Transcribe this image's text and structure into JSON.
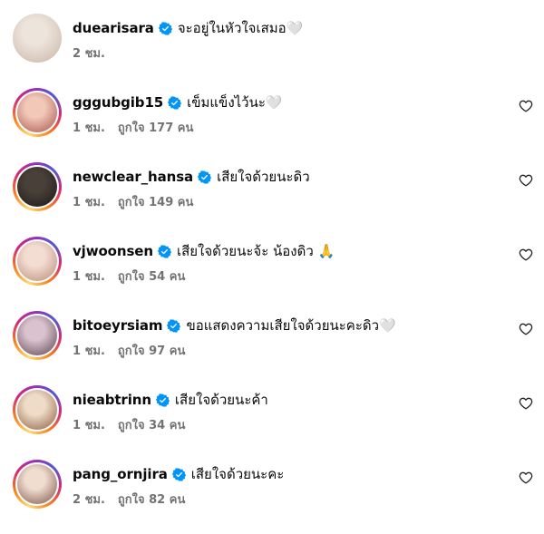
{
  "comments": [
    {
      "username": "duearisara",
      "text": "จะอยู่ในหัวใจเสมอ🤍",
      "time": "2 ชม.",
      "likes": "",
      "has_ring": false,
      "has_heart": false,
      "avatar_colors": [
        "#ede4dc",
        "#c9b4a4"
      ]
    },
    {
      "username": "gggubgib15",
      "text": "เข็มแข็งไว้นะ🤍",
      "time": "1 ชม.",
      "likes": "ถูกใจ 177 คน",
      "has_ring": true,
      "has_heart": true,
      "avatar_colors": [
        "#f2c8b8",
        "#a5524a"
      ]
    },
    {
      "username": "newclear_hansa",
      "text": "เสียใจด้วยนะดิว",
      "time": "1 ชม.",
      "likes": "ถูกใจ 149 คน",
      "has_ring": true,
      "has_heart": true,
      "avatar_colors": [
        "#4a403a",
        "#1c1816"
      ]
    },
    {
      "username": "vjwoonsen",
      "text": "เสียใจด้วยนะจ้ะ น้องดิว 🙏",
      "time": "1 ชม.",
      "likes": "ถูกใจ 54 คน",
      "has_ring": true,
      "has_heart": true,
      "avatar_colors": [
        "#f3ddd2",
        "#b88a76"
      ]
    },
    {
      "username": "bitoeyrsiam",
      "text": "ขอแสดงความเสียใจด้วยนะคะดิว🤍",
      "time": "1 ชม.",
      "likes": "ถูกใจ 97 คน",
      "has_ring": true,
      "has_heart": true,
      "avatar_colors": [
        "#d9c3cf",
        "#5a3f4c"
      ]
    },
    {
      "username": "nieabtrinn",
      "text": "เสียใจด้วยนะค้า",
      "time": "1 ชม.",
      "likes": "ถูกใจ 34 คน",
      "has_ring": true,
      "has_heart": true,
      "avatar_colors": [
        "#efdcc8",
        "#8a5a3c"
      ]
    },
    {
      "username": "pang_ornjira",
      "text": "เสียใจด้วยนะคะ",
      "time": "2 ชม.",
      "likes": "ถูกใจ 82 คน",
      "has_ring": true,
      "has_heart": true,
      "avatar_colors": [
        "#f0ddd0",
        "#7a5244"
      ]
    }
  ],
  "icons": {
    "verified": "verified-badge-icon",
    "like": "heart-outline-icon"
  },
  "colors": {
    "verified": "#0095f6",
    "meta_text": "#737373",
    "text": "#0a0a0a"
  }
}
